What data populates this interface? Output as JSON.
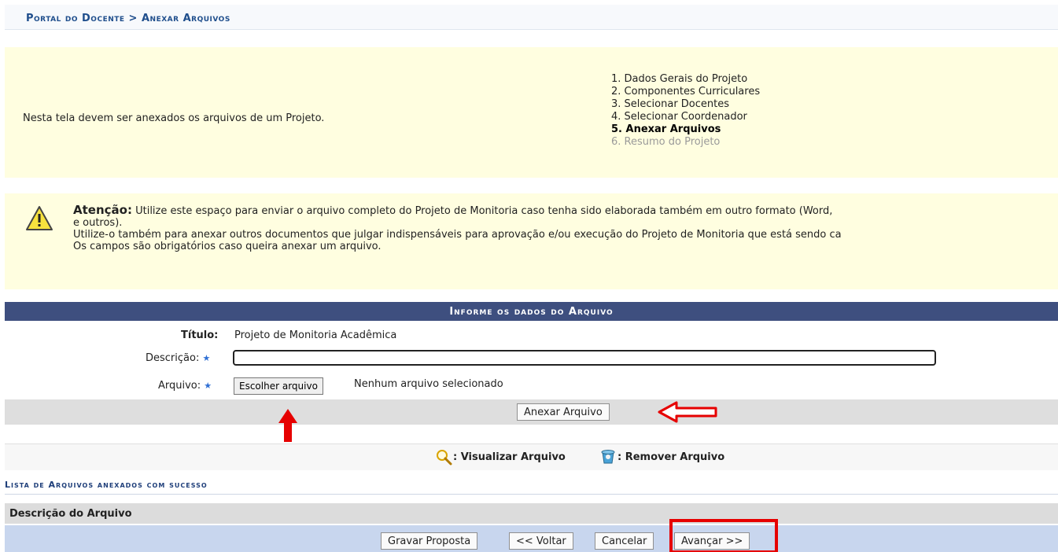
{
  "breadcrumb": "Portal do Docente > Anexar Arquivos",
  "intro": {
    "text": "Nesta tela devem ser anexados os arquivos de um Projeto.",
    "steps": [
      {
        "label": "1. Dados Gerais do Projeto",
        "state": "done"
      },
      {
        "label": "2. Componentes Curriculares",
        "state": "done"
      },
      {
        "label": "3. Selecionar Docentes",
        "state": "done"
      },
      {
        "label": "4. Selecionar Coordenador",
        "state": "done"
      },
      {
        "label": "5. Anexar Arquivos",
        "state": "active"
      },
      {
        "label": "6. Resumo do Projeto",
        "state": "disabled"
      }
    ]
  },
  "warning": {
    "title": "Atenção:",
    "line1": "Utilize este espaço para enviar o arquivo completo do Projeto de Monitoria caso tenha sido elaborada também em outro formato (Word,",
    "line2": "e outros).",
    "line3": "Utilize-o também para anexar outros documentos que julgar indispensáveis para aprovação e/ou execução do Projeto de Monitoria que está sendo ca",
    "line4": "Os campos são obrigatórios caso queira anexar um arquivo."
  },
  "form": {
    "header": "Informe os dados do Arquivo",
    "titulo_label": "Título:",
    "titulo_value": "Projeto de Monitoria Acadêmica",
    "descricao_label": "Descrição:",
    "descricao_value": "",
    "arquivo_label": "Arquivo:",
    "file_button": "Escolher arquivo",
    "file_status": "Nenhum arquivo selecionado",
    "required_mark": "★",
    "attach_button": "Anexar Arquivo"
  },
  "legend": {
    "view": ": Visualizar Arquivo",
    "remove": ": Remover Arquivo"
  },
  "list": {
    "title": "Lista de Arquivos anexados com sucesso",
    "column": "Descrição do Arquivo"
  },
  "footer": {
    "save": "Gravar Proposta",
    "back": "<< Voltar",
    "cancel": "Cancelar",
    "next": "Avançar >>"
  },
  "colors": {
    "accent": "#3e4f7f",
    "highlight": "#e60000",
    "notice_bg": "#fffee0"
  }
}
